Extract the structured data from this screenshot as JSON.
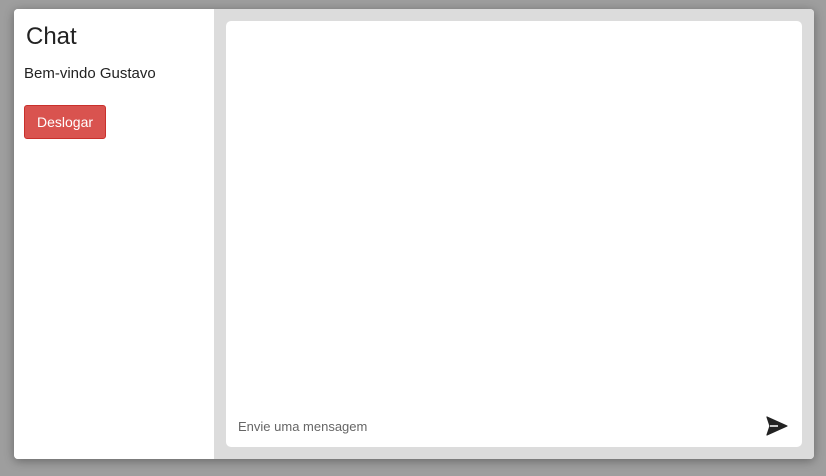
{
  "sidebar": {
    "title": "Chat",
    "welcome": "Bem-vindo Gustavo",
    "logout_label": "Deslogar"
  },
  "composer": {
    "placeholder": "Envie uma mensagem",
    "value": "",
    "send_icon": "send-icon"
  },
  "colors": {
    "logout_button": "#d9534f",
    "main_background": "#dcdcdc"
  }
}
